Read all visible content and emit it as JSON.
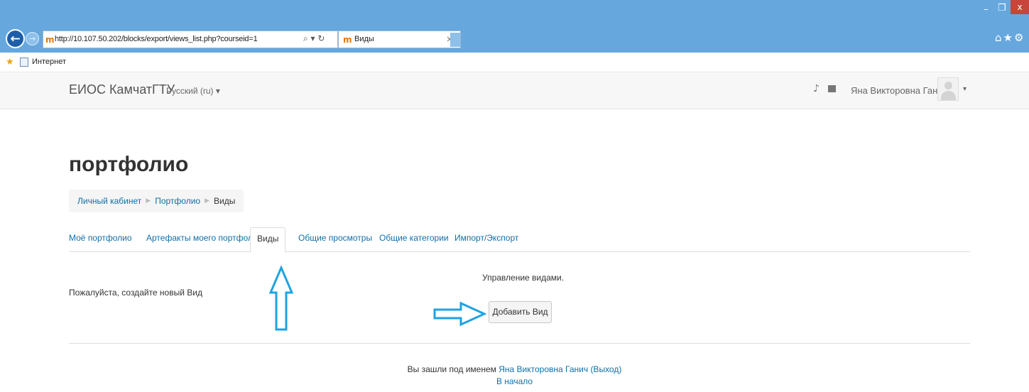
{
  "browser": {
    "url": "http://10.107.50.202/blocks/export/views_list.php?courseid=1",
    "url_icons": "⌕ ▾ ↻",
    "tab_title": "Виды",
    "tab_close": "×",
    "moodle_glyph": "m",
    "back_glyph": "←",
    "forward_glyph": "→",
    "win_min": "–",
    "win_max": "❒",
    "win_close": "x",
    "right_icons": "⌂★⚙",
    "fav_star_glyph": "★",
    "favorites_label": "Интернет"
  },
  "navbar": {
    "brand": "ЕИОС КамчатГТУ",
    "language": "Русский (ru) ▾",
    "bell_glyph": "♪",
    "user_name": "Яна Викторовна Ганич",
    "user_caret": "▾"
  },
  "page": {
    "title": "портфолио",
    "breadcrumb": [
      {
        "label": "Личный кабинет"
      },
      {
        "label": "Портфолио"
      },
      {
        "label": "Виды"
      }
    ],
    "breadcrumb_separator": "▶",
    "tabs": [
      {
        "label": "Моё портфолио"
      },
      {
        "label": "Артефакты моего портфолио"
      },
      {
        "label": "Виды",
        "active": true
      },
      {
        "label": "Общие просмотры"
      },
      {
        "label": "Общие категории"
      },
      {
        "label": "Импорт/Экспорт"
      }
    ],
    "manage_text": "Управление видами.",
    "create_prompt": "Пожалуйста, создайте новый Вид",
    "add_button": "Добавить Вид"
  },
  "footer": {
    "logged_in_prefix": "Вы зашли под именем",
    "logged_in_user": "Яна Викторовна Ганич",
    "logout": "(Выход)",
    "home": "В начало"
  },
  "colors": {
    "browser_chrome": "#66a7de",
    "link": "#0f6fa8",
    "annotation_arrow": "#1ea3e0"
  }
}
